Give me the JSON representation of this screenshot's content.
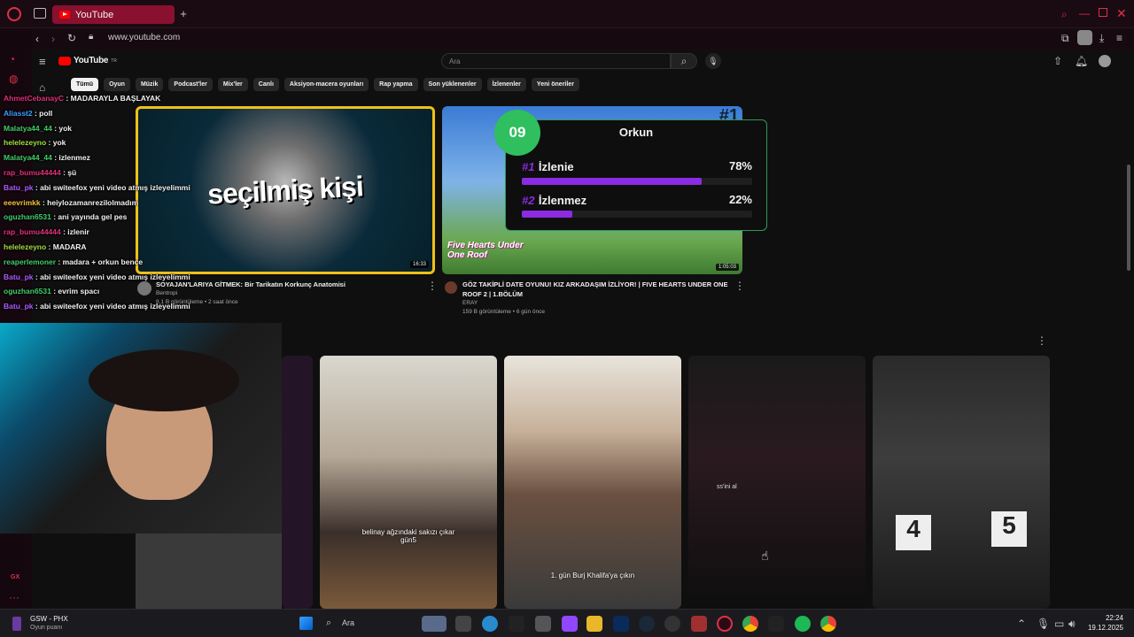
{
  "browser": {
    "tab_title": "YouTube",
    "url": "www.youtube.com"
  },
  "youtube": {
    "logo_text": "YouTube",
    "logo_sup": "TR",
    "search_placeholder": "Ara",
    "chips": [
      "Tümü",
      "Oyun",
      "Müzik",
      "Podcast'ler",
      "Mix'ler",
      "Canlı",
      "Aksiyon-macera oyunları",
      "Rap yapma",
      "Son yüklenenler",
      "İzlenenler",
      "Yeni öneriler"
    ],
    "videos": [
      {
        "thumb_text": "seçilmiş kişi",
        "duration": "16:33",
        "title": "SOYAJAN'LARIYA GİTMEK: Bir Tarikatın Korkunç Anatomisi",
        "channel": "Bentropi",
        "meta": "8,1 B görüntüleme • 2 saat önce"
      },
      {
        "thumb_text": "Five Hearts Under One Roof",
        "badge": "#1",
        "duration": "1:05:03",
        "title": "GÖZ TAKİPLİ DATE OYUNU! KIZ ARKADAŞIM İZLİYOR! | FIVE HEARTS UNDER ONE ROOF 2 | 1.BÖLÜM",
        "channel": "ERAY",
        "meta": "159 B görüntüleme • 6 gün önce"
      }
    ],
    "shorts": [
      {
        "caption": "belinay ağzındaki sakızı çıkar gün5"
      },
      {
        "caption": "1. gün Burj Khalifa'ya çıkın"
      },
      {
        "caption": "ss'ini al"
      },
      {
        "caption": ""
      },
      {
        "caption": ""
      }
    ]
  },
  "chat": [
    {
      "user": "AhmetCebanayC",
      "msg": "MADARAYLA BAŞLAYAK",
      "color": "#e0307a"
    },
    {
      "user": "Aliasst2",
      "msg": "poll",
      "color": "#3aa0ff"
    },
    {
      "user": "Malatya44_44",
      "msg": "yok",
      "color": "#3fcf6a"
    },
    {
      "user": "helelezeyno",
      "msg": "yok",
      "color": "#9fe03f"
    },
    {
      "user": "Malatya44_44",
      "msg": "izlenmez",
      "color": "#3fcf6a"
    },
    {
      "user": "rap_bumu44444",
      "msg": "şü",
      "color": "#e0307a"
    },
    {
      "user": "Batu_pk",
      "msg": "abi switeefox yeni video atmış izleyelimmi",
      "color": "#b05cff"
    },
    {
      "user": "eeevrimkk",
      "msg": "heiylozamanrezilolmadım",
      "color": "#f3c23a"
    },
    {
      "user": "oguzhan6531",
      "msg": "ani yayında gel pes",
      "color": "#3fcf6a"
    },
    {
      "user": "rap_bumu44444",
      "msg": "izlenir",
      "color": "#e0307a"
    },
    {
      "user": "helelezeyno",
      "msg": "MADARA",
      "color": "#9fe03f"
    },
    {
      "user": "reaperlemoner",
      "msg": "madara + orkun bence",
      "color": "#3fcf6a"
    },
    {
      "user": "Batu_pk",
      "msg": "abi switeefox yeni video atmış izleyelimmi",
      "color": "#b05cff"
    },
    {
      "user": "oguzhan6531",
      "msg": "evrim spacı",
      "color": "#3fcf6a"
    },
    {
      "user": "Batu_pk",
      "msg": "abi switeefox yeni video atmış izleyelimmi",
      "color": "#b05cff"
    }
  ],
  "poll": {
    "number": "09",
    "title": "Orkun",
    "options": [
      {
        "rank": "#1",
        "label": "İzlenie",
        "pct": "78%",
        "value": 0.78
      },
      {
        "rank": "#2",
        "label": "İzlenmez",
        "pct": "22%",
        "value": 0.22
      }
    ]
  },
  "taskbar": {
    "game_title": "GSW - PHX",
    "game_sub": "Oyun puanı",
    "search": "Ara",
    "time": "22:24",
    "date": "19.12.2025"
  },
  "colors": {
    "accent": "#ff0000",
    "opera_red": "#8a1030",
    "poll_bar": "#8b2be2",
    "poll_border": "#2f9a55"
  }
}
